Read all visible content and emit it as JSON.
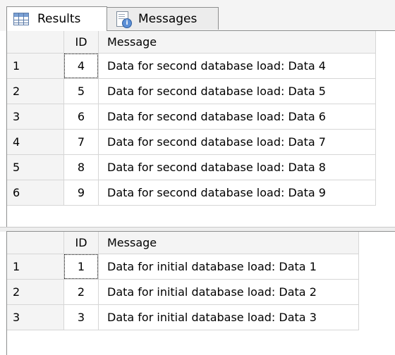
{
  "tabs": [
    {
      "label": "Results",
      "icon": "results-grid-icon",
      "active": true
    },
    {
      "label": "Messages",
      "icon": "messages-icon",
      "active": false
    }
  ],
  "result_sets": [
    {
      "columns": [
        "ID",
        "Message"
      ],
      "rows": [
        {
          "num": "1",
          "id": "4",
          "message": "Data for second database load: Data 4"
        },
        {
          "num": "2",
          "id": "5",
          "message": "Data for second database load: Data 5"
        },
        {
          "num": "3",
          "id": "6",
          "message": "Data for second database load: Data 6"
        },
        {
          "num": "4",
          "id": "7",
          "message": "Data for second database load: Data 7"
        },
        {
          "num": "5",
          "id": "8",
          "message": "Data for second database load: Data 8"
        },
        {
          "num": "6",
          "id": "9",
          "message": "Data for second database load: Data 9"
        }
      ]
    },
    {
      "columns": [
        "ID",
        "Message"
      ],
      "rows": [
        {
          "num": "1",
          "id": "1",
          "message": "Data for initial database load: Data 1"
        },
        {
          "num": "2",
          "id": "2",
          "message": "Data for initial database load: Data 2"
        },
        {
          "num": "3",
          "id": "3",
          "message": "Data for initial database load: Data 3"
        }
      ]
    }
  ]
}
